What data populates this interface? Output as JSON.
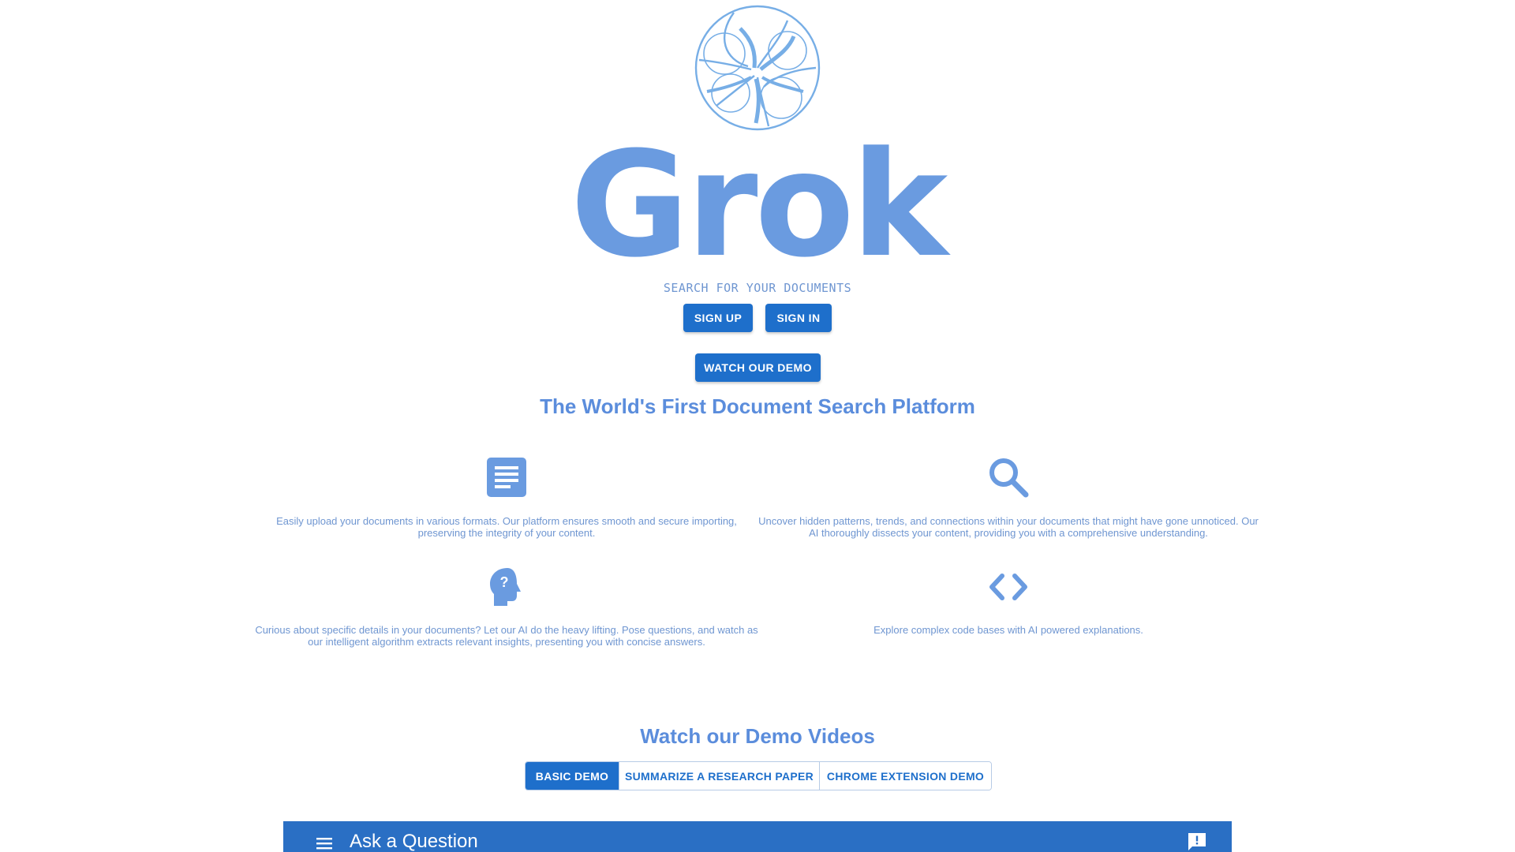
{
  "brand": {
    "name": "Grok",
    "tagline": "SEARCH FOR YOUR DOCUMENTS",
    "accent_color": "#6a9be0",
    "button_color": "#1e6fcb"
  },
  "auth": {
    "signup_label": "SIGN UP",
    "signin_label": "SIGN IN"
  },
  "demo_button_label": "WATCH OUR DEMO",
  "headline": "The World's First Document Search Platform",
  "features": [
    {
      "icon": "document-icon",
      "text": "Easily upload your documents in various formats. Our platform ensures smooth and secure importing, preserving the integrity of your content."
    },
    {
      "icon": "search-icon",
      "text": "Uncover hidden patterns, trends, and connections within your documents that might have gone unnoticed. Our AI thoroughly dissects your content, providing you with a comprehensive understanding."
    },
    {
      "icon": "question-head-icon",
      "text": "Curious about specific details in your documents? Let our AI do the heavy lifting. Pose questions, and watch as our intelligent algorithm extracts relevant insights, presenting you with concise answers."
    },
    {
      "icon": "code-icon",
      "text": "Explore complex code bases with AI powered explanations."
    }
  ],
  "demo_section": {
    "title": "Watch our Demo Videos",
    "tabs": [
      {
        "label": "BASIC DEMO",
        "active": true
      },
      {
        "label": "SUMMARIZE A RESEARCH PAPER",
        "active": false
      },
      {
        "label": "CHROME EXTENSION DEMO",
        "active": false
      }
    ],
    "video": {
      "title": "Ask a Question",
      "menu_icon": "menu-icon",
      "feedback_icon": "feedback-icon"
    }
  }
}
